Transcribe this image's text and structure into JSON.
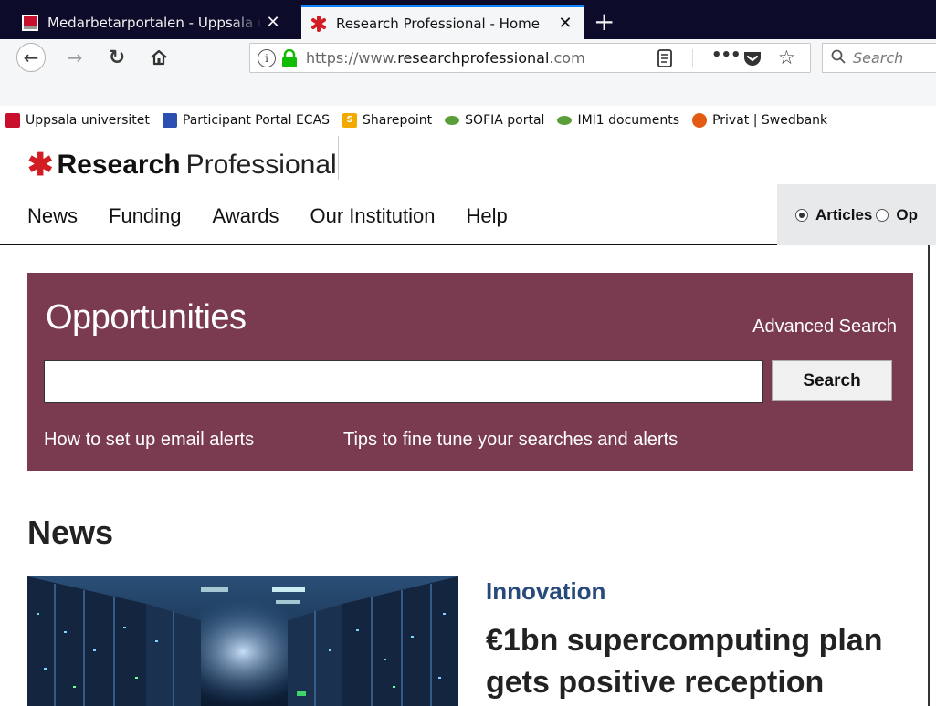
{
  "browser": {
    "tabs": [
      {
        "title": "Medarbetarportalen - Uppsala universitet",
        "active": false
      },
      {
        "title": "Research Professional - Home",
        "active": true
      }
    ],
    "tab_close_glyph": "✕",
    "new_tab_glyph": "+",
    "url_prefix": "https://www.",
    "url_host": "researchprofessional",
    "url_suffix": ".com",
    "search_placeholder": "Search",
    "bookmarks": [
      {
        "label": "Uppsala universitet",
        "icon": "uppsala-icon",
        "color": "#c8102e"
      },
      {
        "label": "Participant Portal ECAS",
        "icon": "eu-flag-icon",
        "color": "#2a4fb0"
      },
      {
        "label": "Sharepoint",
        "icon": "sharepoint-icon",
        "color": "#f2a900"
      },
      {
        "label": "SOFIA portal",
        "icon": "imi-icon",
        "color": "#5a9e3a"
      },
      {
        "label": "IMI1 documents",
        "icon": "imi-icon",
        "color": "#5a9e3a"
      },
      {
        "label": "Privat | Swedbank",
        "icon": "swedbank-icon",
        "color": "#e35a12"
      }
    ]
  },
  "site": {
    "logo_star": "✱",
    "logo_strong": "Research",
    "logo_light": "Professional",
    "nav": [
      "News",
      "Funding",
      "Awards",
      "Our Institution",
      "Help"
    ],
    "search_scope": {
      "articles": "Articles",
      "opportunities": "Op"
    }
  },
  "opportunities": {
    "title": "Opportunities",
    "advanced_search": "Advanced Search",
    "search_button": "Search",
    "search_value": "",
    "link_email_alerts": "How to set up email alerts",
    "link_tips": "Tips to fine tune your searches and alerts",
    "bg_color": "#7a3a4f"
  },
  "news": {
    "heading": "News",
    "category": "Innovation",
    "headline": "€1bn supercomputing plan gets positive reception"
  },
  "colors": {
    "brand_red": "#d31d25",
    "tab_bar": "#0c0c2a",
    "category_blue": "#274a7a"
  }
}
